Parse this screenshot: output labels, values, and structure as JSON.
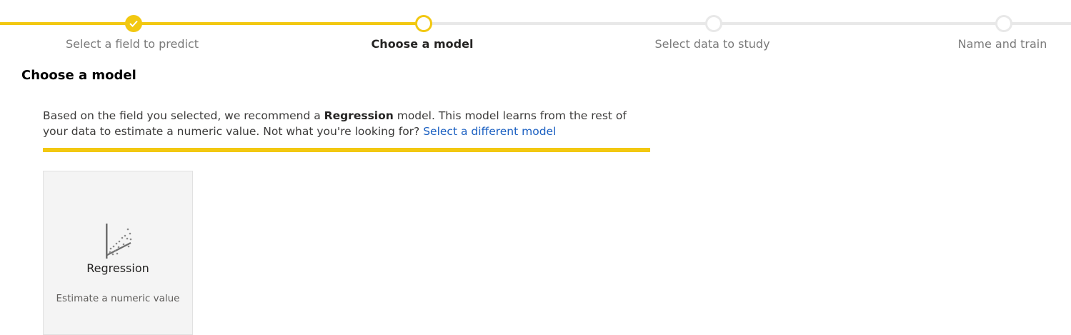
{
  "stepper": {
    "steps": [
      {
        "label": "Select a field to predict",
        "state": "done"
      },
      {
        "label": "Choose a model",
        "state": "current"
      },
      {
        "label": "Select data to study",
        "state": "todo"
      },
      {
        "label": "Name and train",
        "state": "todo"
      }
    ]
  },
  "page": {
    "title": "Choose a model"
  },
  "recommendation": {
    "text_before": "Based on the field you selected, we recommend a ",
    "model_name": "Regression",
    "text_after": " model. This model learns from the rest of your data to estimate a numeric value. Not what you're looking for? ",
    "link_label": "Select a different model"
  },
  "model_card": {
    "title": "Regression",
    "description": "Estimate a numeric value",
    "icon": "regression-scatter-icon"
  },
  "colors": {
    "accent": "#f2c811",
    "track": "#e8e8e8",
    "link": "#1a5fc1"
  }
}
